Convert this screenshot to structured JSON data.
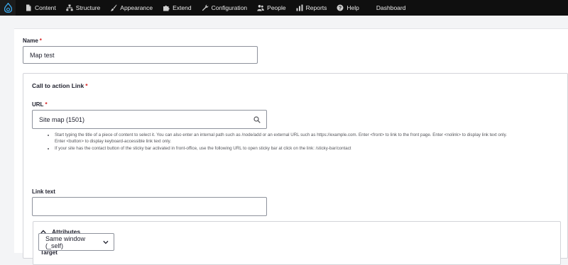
{
  "toolbar": {
    "items": [
      {
        "label": "Content",
        "icon": "file-icon"
      },
      {
        "label": "Structure",
        "icon": "sitemap-icon"
      },
      {
        "label": "Appearance",
        "icon": "brush-icon"
      },
      {
        "label": "Extend",
        "icon": "puzzle-icon"
      },
      {
        "label": "Configuration",
        "icon": "wrench-icon"
      },
      {
        "label": "People",
        "icon": "people-icon"
      },
      {
        "label": "Reports",
        "icon": "chart-icon"
      },
      {
        "label": "Help",
        "icon": "help-icon"
      }
    ],
    "dashboard": "Dashboard"
  },
  "form": {
    "name_label": "Name",
    "name_value": "Map test",
    "cta_title": "Call to action Link",
    "url_label": "URL",
    "url_value": "Site map (1501)",
    "help1a": "Start typing the title of a piece of content to select it. You can also enter an internal path such as /node/add or an external URL such as https://example.com. Enter <front> to link to the front page. Enter <nolink> to display link text only.",
    "help1b": "Enter <button> to display keyboard-accessible link text only.",
    "help2": "If your site has the contact button of the sticky bar activated in front-office, use the following URL to open sticky bar at click on the link: /sticky-bar/contact",
    "link_text_label": "Link text",
    "link_text_value": "",
    "attributes_label": "Attributes",
    "target_label": "Target",
    "target_value": "Same window (_self)",
    "required_mark": "*"
  },
  "colors": {
    "toolbar_bg": "#0f0f0f",
    "required": "#d72222",
    "drupal_blue": "#3aa6e8"
  }
}
